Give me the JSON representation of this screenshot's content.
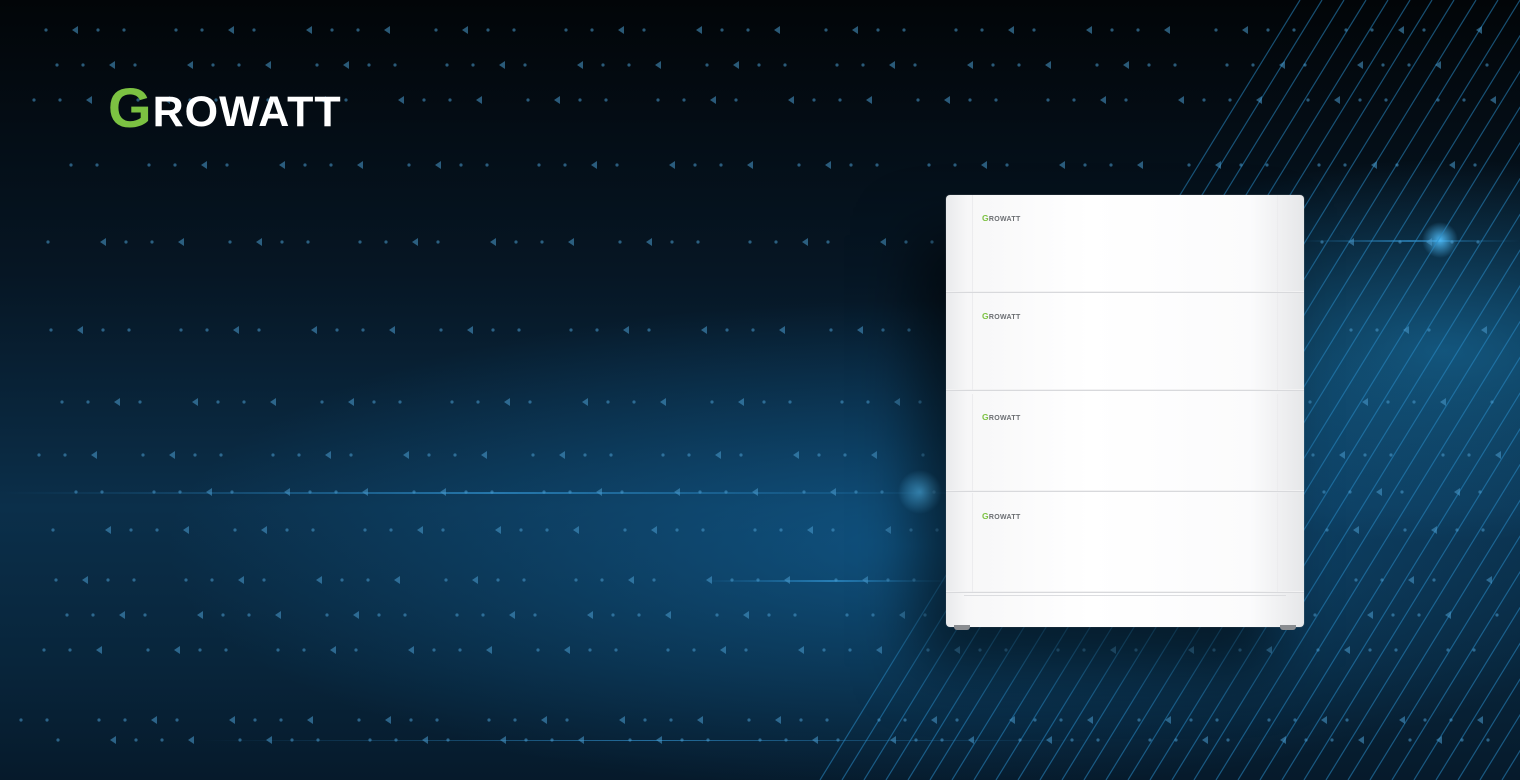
{
  "brand": {
    "logo_initial": "G",
    "logo_rest": "ROWATT",
    "accent_color": "#7cc242",
    "logo_icon": "growatt-logo"
  },
  "product": {
    "icon": "battery-stack",
    "modules": [
      {
        "label_initial": "G",
        "label_rest": "ROWATT"
      },
      {
        "label_initial": "G",
        "label_rest": "ROWATT"
      },
      {
        "label_initial": "G",
        "label_rest": "ROWATT"
      },
      {
        "label_initial": "G",
        "label_rest": "ROWATT"
      }
    ]
  }
}
